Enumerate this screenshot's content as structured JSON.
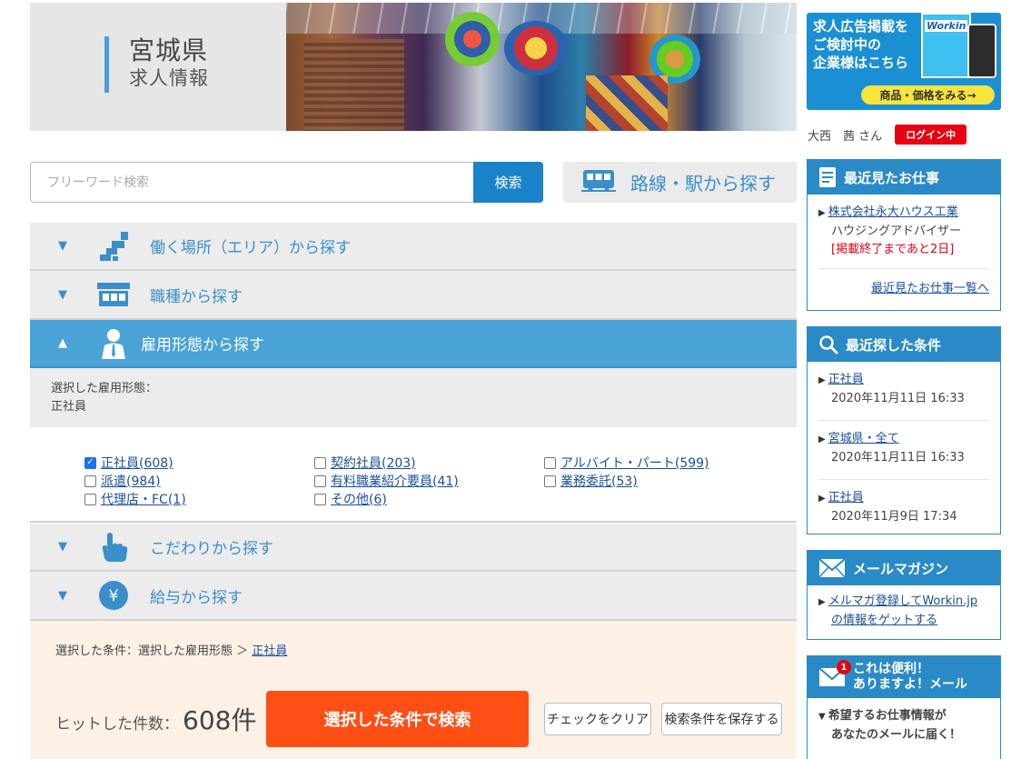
{
  "hero": {
    "title": "宮城県",
    "subtitle": "求人情報"
  },
  "search": {
    "placeholder": "フリーワード検索",
    "button_label": "検索",
    "route_label": "路線・駅から探す"
  },
  "accordion": {
    "area": "働く場所（エリア）から探す",
    "job_type": "職種から探す",
    "employment": "雇用形態から探す",
    "kodawari": "こだわりから探す",
    "salary": "給与から探す"
  },
  "selected_employment": {
    "label": "選択した雇用形態：",
    "value": "正社員"
  },
  "employment_options": [
    {
      "label": "正社員(608)",
      "checked": true
    },
    {
      "label": "派遣(984)",
      "checked": false
    },
    {
      "label": "代理店・FC(1)",
      "checked": false
    },
    {
      "label": "契約社員(203)",
      "checked": false
    },
    {
      "label": "有料職業紹介要員(41)",
      "checked": false
    },
    {
      "label": "その他(6)",
      "checked": false
    },
    {
      "label": "アルバイト・パート(599)",
      "checked": false
    },
    {
      "label": "業務委託(53)",
      "checked": false
    }
  ],
  "conditions": {
    "prefix": "選択した条件：選択した雇用形態 ＞",
    "value": "正社員",
    "hits_label": "ヒットした件数：",
    "hits_count": "608件",
    "search_button": "選択した条件で検索",
    "clear_button": "チェックをクリア",
    "save_button": "検索条件を保存する"
  },
  "ad": {
    "line1": "求人広告掲載を",
    "line2": "ご検討中の",
    "line3": "企業様はこちら",
    "cta": "商品・価格をみる→",
    "logo": "Workin"
  },
  "user": {
    "name": "大西　茜 さん",
    "status": "ログイン中"
  },
  "recent_jobs": {
    "title": "最近見たお仕事",
    "company": "株式会社永大ハウス工業",
    "position": "ハウジングアドバイザー",
    "deadline": "[掲載終了まであと2日]",
    "more_link": "最近見たお仕事一覧へ"
  },
  "recent_searches": {
    "title": "最近探した条件",
    "items": [
      {
        "label": "正社員",
        "date": "2020年11月11日 16:33"
      },
      {
        "label": "宮城県・全て",
        "date": "2020年11月11日 16:33"
      },
      {
        "label": "正社員",
        "date": "2020年11月9日 17:34"
      }
    ]
  },
  "mail_magazine": {
    "title": "メールマガジン",
    "link_line1": "メルマガ登録してWorkin.jp",
    "link_line2": "の情報をゲットする"
  },
  "alert_mail": {
    "title_line1": "これは便利！",
    "title_line2": "ありますよ！メール",
    "badge": "1",
    "desc_line1": "希望するお仕事情報が",
    "desc_line2": "あなたのメールに届く！"
  },
  "colors": {
    "accent": "#4aa3d6",
    "primary_blue": "#1a82c8",
    "cta_orange": "#ff4f14",
    "login_red": "#e60012"
  }
}
